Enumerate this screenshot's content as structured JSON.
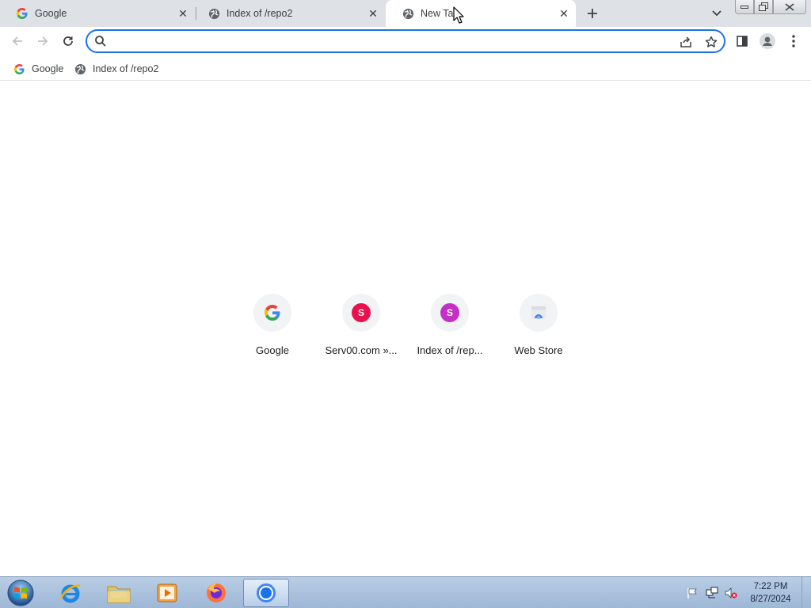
{
  "browser": {
    "tabs": [
      {
        "title": "Google",
        "icon": "google-g-icon",
        "active": false
      },
      {
        "title": "Index of /repo2",
        "icon": "globe-icon",
        "active": false
      },
      {
        "title": "New Tab",
        "icon": "globe-icon",
        "active": true
      }
    ],
    "new_tab_symbol": "+",
    "close_symbol": "✕"
  },
  "omnibox": {
    "value": "",
    "placeholder": ""
  },
  "bookmarks": [
    {
      "label": "Google",
      "icon": "google-g-icon"
    },
    {
      "label": "Index of /repo2",
      "icon": "globe-icon"
    }
  ],
  "shortcuts": [
    {
      "label": "Google",
      "icon": "google-g-icon",
      "letter": "",
      "color": ""
    },
    {
      "label": "Serv00.com »...",
      "icon": "letter-s-icon",
      "letter": "S",
      "color": "#e8114c"
    },
    {
      "label": "Index of /rep...",
      "icon": "letter-s-icon",
      "letter": "S",
      "color": "#c42fc8"
    },
    {
      "label": "Web Store",
      "icon": "web-store-icon",
      "letter": "",
      "color": ""
    }
  ],
  "taskbar": {
    "apps": [
      "internet-explorer",
      "file-explorer",
      "media-player",
      "firefox",
      "chrome"
    ],
    "clock_time": "7:22 PM",
    "clock_date": "8/27/2024"
  },
  "colors": {
    "accent": "#1a73e8",
    "tabstrip": "#dee1e6",
    "taskbar": "#b9cde5"
  }
}
